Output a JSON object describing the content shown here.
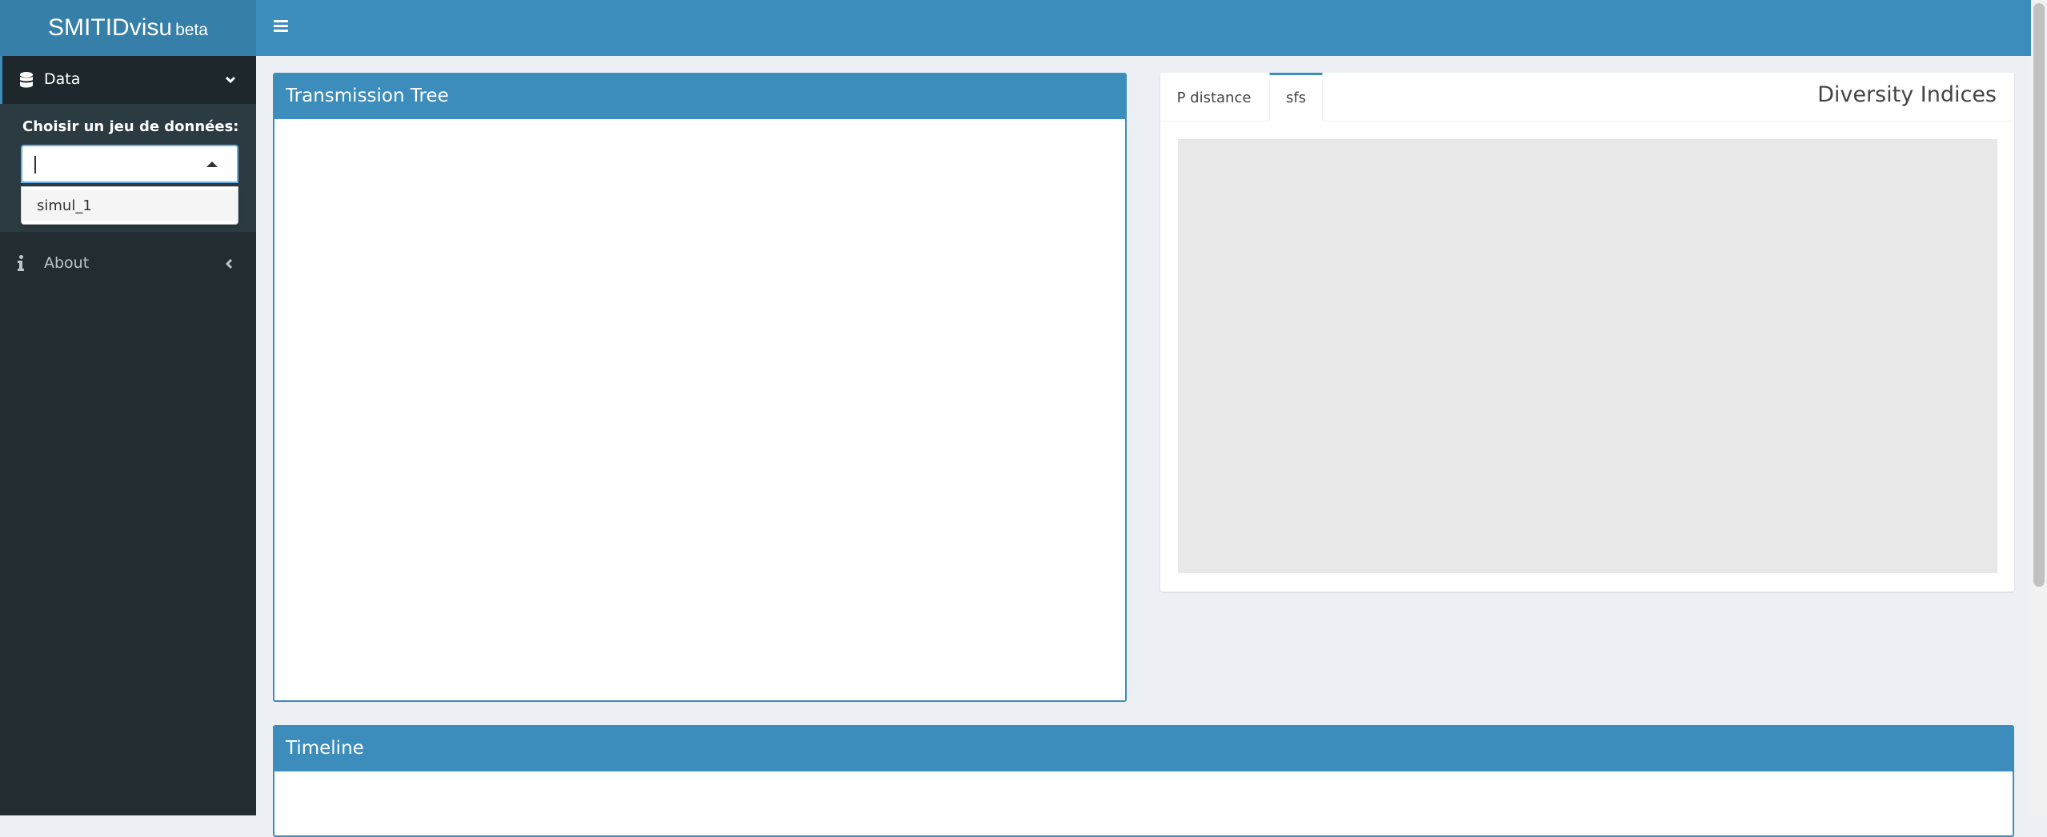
{
  "app": {
    "title": "SMITIDvisu",
    "badge": "beta"
  },
  "sidebar": {
    "data_menu": {
      "label": "Data",
      "icon": "database-icon",
      "chevron": "chevron-down-icon"
    },
    "dataset_select": {
      "label": "Choisir un jeu de données:",
      "value": "",
      "options": [
        "simul_1"
      ]
    },
    "about_menu": {
      "label": "About",
      "icon": "info-icon",
      "chevron": "chevron-left-icon"
    }
  },
  "main": {
    "transmission_tree": {
      "title": "Transmission Tree"
    },
    "diversity": {
      "title": "Diversity Indices",
      "tabs": [
        "P distance",
        "sfs"
      ],
      "active_tab": "sfs"
    },
    "timeline": {
      "title": "Timeline"
    }
  },
  "colors": {
    "header": "#3c8dbc",
    "logo_bg": "#367fa9",
    "sidebar_bg": "#222d32",
    "content_bg": "#ecf0f5"
  }
}
